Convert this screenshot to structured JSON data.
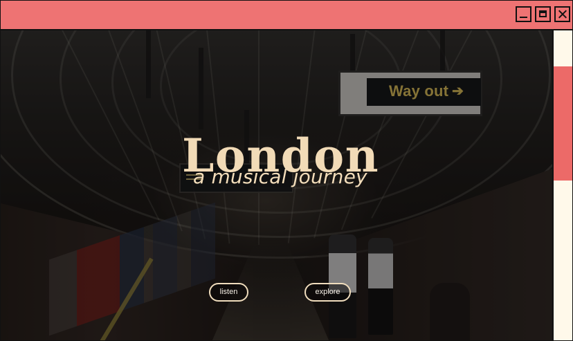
{
  "window": {
    "controls": {
      "minimize_icon": "minimize-icon",
      "maximize_icon": "maximize-icon",
      "close_icon": "close-icon"
    },
    "colors": {
      "titlebar": "#ee7373",
      "scrollbar_track": "#fff9ea",
      "scrollbar_thumb": "#ec6a68"
    }
  },
  "hero": {
    "title": "London",
    "subtitle": "a musical journey",
    "sign_text": "Way out",
    "sign_arrow": "➔",
    "buttons": {
      "listen": "listen",
      "explore": "explore"
    },
    "colors": {
      "title": "#f2dbb7",
      "button_border": "#f0ddbd",
      "sign_text": "#d1b553"
    }
  }
}
